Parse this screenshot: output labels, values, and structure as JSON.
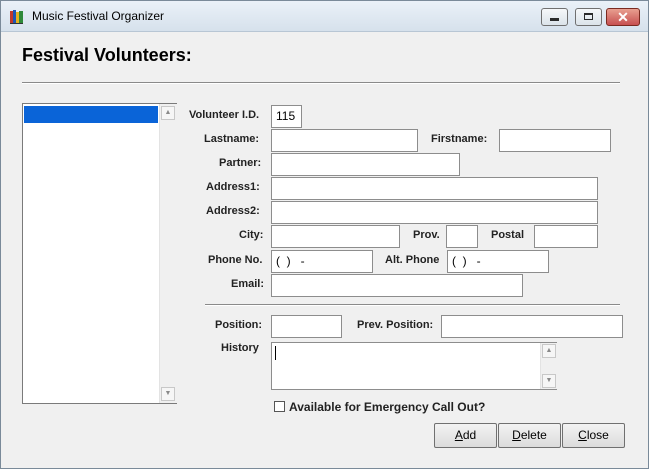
{
  "window": {
    "title": "Music Festival Organizer",
    "app_icon": "books-icon"
  },
  "caption_buttons": {
    "minimize": "minimize-icon",
    "maximize": "maximize-icon",
    "close": "close-icon",
    "close_glyph": "✕"
  },
  "header": {
    "title": "Festival Volunteers:"
  },
  "form": {
    "volunteer_id": {
      "label": "Volunteer I.D.",
      "value": "115"
    },
    "lastname": {
      "label": "Lastname:",
      "value": ""
    },
    "firstname": {
      "label": "Firstname:",
      "value": ""
    },
    "partner": {
      "label": "Partner:",
      "value": ""
    },
    "address1": {
      "label": "Address1:",
      "value": ""
    },
    "address2": {
      "label": "Address2:",
      "value": ""
    },
    "city": {
      "label": "City:",
      "value": ""
    },
    "prov": {
      "label": "Prov.",
      "value": ""
    },
    "postal": {
      "label": "Postal",
      "value": ""
    },
    "phone": {
      "label": "Phone No.",
      "value": "(  )   -"
    },
    "alt_phone": {
      "label": "Alt. Phone",
      "value": "(  )   -"
    },
    "email": {
      "label": "Email:",
      "value": ""
    },
    "position": {
      "label": "Position:",
      "value": ""
    },
    "prev_position": {
      "label": "Prev. Position:",
      "value": ""
    },
    "history": {
      "label": "History",
      "value": ""
    },
    "emergency": {
      "label": "Available for Emergency Call Out?",
      "checked": false
    }
  },
  "buttons": {
    "add": {
      "mnemonic": "A",
      "rest": "dd"
    },
    "delete": {
      "mnemonic": "D",
      "rest": "elete"
    },
    "close": {
      "mnemonic": "C",
      "rest": "lose"
    }
  },
  "scroll_glyphs": {
    "up": "▲",
    "down": "▼"
  },
  "colors": {
    "selection": "#0a64d8",
    "window_bg": "#f0f0f0",
    "close_button": "#c75050"
  }
}
